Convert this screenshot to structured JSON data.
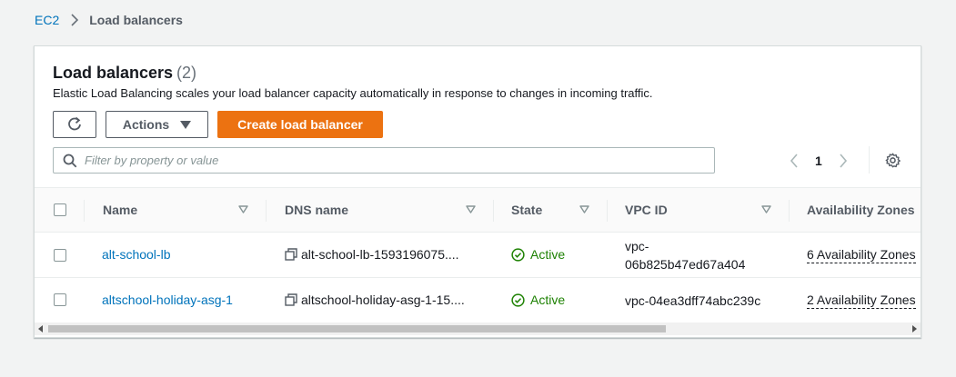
{
  "breadcrumb": {
    "root": "EC2",
    "current": "Load balancers"
  },
  "header": {
    "title": "Load balancers",
    "count": "(2)",
    "description": "Elastic Load Balancing scales your load balancer capacity automatically in response to changes in incoming traffic."
  },
  "toolbar": {
    "refresh_icon": "refresh-icon",
    "actions_label": "Actions",
    "create_label": "Create load balancer"
  },
  "filter": {
    "placeholder": "Filter by property or value",
    "value": ""
  },
  "pagination": {
    "current_page": "1"
  },
  "table": {
    "columns": [
      "Name",
      "DNS name",
      "State",
      "VPC ID",
      "Availability Zones"
    ],
    "rows": [
      {
        "name": "alt-school-lb",
        "dns": "alt-school-lb-1593196075....",
        "state": "Active",
        "vpc_line1": "vpc-",
        "vpc_line2": "06b825b47ed67a404",
        "az": "6 Availability Zones"
      },
      {
        "name": "altschool-holiday-asg-1",
        "dns": "altschool-holiday-asg-1-15....",
        "state": "Active",
        "vpc_line1": "vpc-04ea3dff74abc239c",
        "vpc_line2": "",
        "az": "2 Availability Zones"
      }
    ]
  },
  "colors": {
    "link": "#0073bb",
    "primary": "#ec7211",
    "success": "#1d8102",
    "background": "#f2f3f3"
  }
}
